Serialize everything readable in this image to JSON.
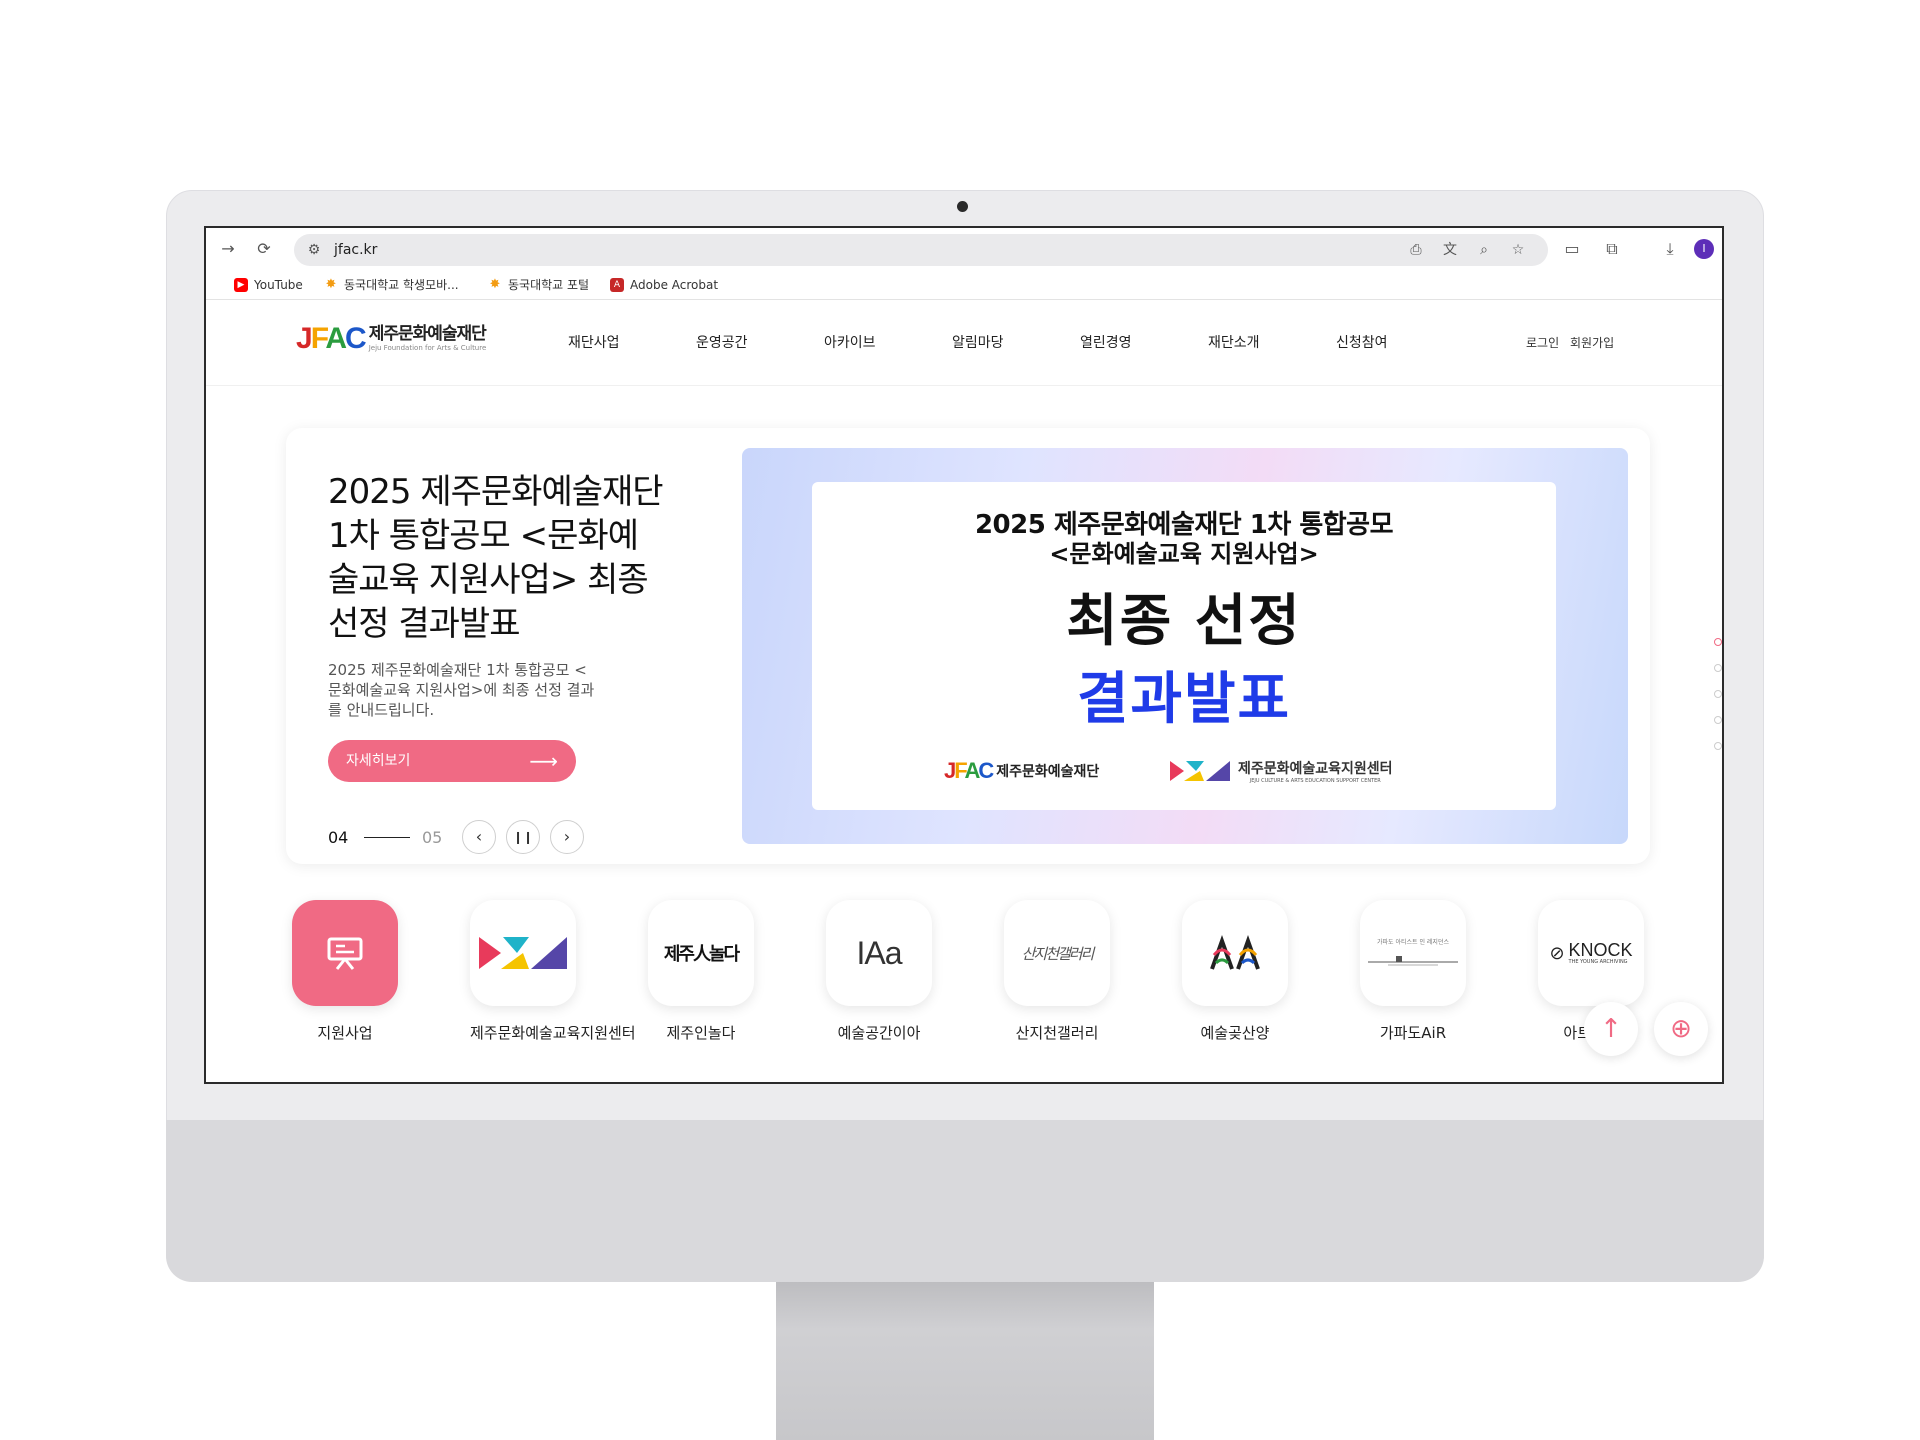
{
  "browser": {
    "url": "jfac.kr",
    "avatar_letter": "I",
    "bookmarks": [
      {
        "label": "YouTube",
        "icon": "youtube-icon",
        "color": "#ff0000"
      },
      {
        "label": "동국대학교 학생모바...",
        "icon": "dongguk-icon",
        "color": "#f39c12"
      },
      {
        "label": "동국대학교 포털",
        "icon": "dongguk-icon",
        "color": "#f39c12"
      },
      {
        "label": "Adobe Acrobat",
        "icon": "acrobat-icon",
        "color": "#c62828"
      }
    ]
  },
  "site": {
    "logo_mark": "JFAC",
    "logo_ko": "제주문화예술재단",
    "logo_en": "Jeju Foundation for Arts & Culture",
    "nav": [
      "재단사업",
      "운영공간",
      "아카이브",
      "알림마당",
      "열린경영",
      "재단소개",
      "신청참여"
    ],
    "util": {
      "login": "로그인",
      "signup": "회원가입"
    }
  },
  "hero": {
    "title": "2025 제주문화예술재단 1차 통합공모 <문화예술교육 지원사업> 최종선정 결과발표",
    "description": "2025 제주문화예술재단 1차 통합공모 <문화예술교육 지원사업>에 최종 선정 결과를 안내드립니다.",
    "button_label": "자세히보기",
    "current_slide": "04",
    "total_slides": "05",
    "banner": {
      "line1": "2025 제주문화예술재단 1차 통합공모",
      "line2": "<문화예술교육 지원사업>",
      "line3": "최종 선정",
      "line4": "결과발표",
      "logo_left": "제주문화예술재단",
      "logo_right": "제주문화예술교육지원센터",
      "logo_right_en": "JEJU CULTURE & ARTS EDUCATION SUPPORT CENTER"
    }
  },
  "quick_links": [
    {
      "label": "지원사업",
      "icon": "presentation-board-icon"
    },
    {
      "label": "제주문화예술교육지원센터",
      "icon": "arts-education-center-logo"
    },
    {
      "label": "제주인놀다",
      "icon": "jejuin-nolda-logo",
      "logo_text": "제주人놀다"
    },
    {
      "label": "예술공간이아",
      "icon": "iaa-logo",
      "logo_text": "IAa"
    },
    {
      "label": "산지천갤러리",
      "icon": "sanjicheon-gallery-logo",
      "logo_text": "산지천갤러리"
    },
    {
      "label": "예술곶산양",
      "icon": "art-cape-sanyang-logo"
    },
    {
      "label": "가파도AiR",
      "icon": "gapado-air-logo",
      "logo_text": "가파도 아티스트 인 레지던스"
    },
    {
      "label": "아트노크",
      "icon": "knock-logo",
      "logo_text": "KNOCK",
      "logo_sub": "THE YOUNG ARCHIVING"
    }
  ],
  "colors": {
    "accent": "#f06a84",
    "banner_blue": "#1f3be8"
  }
}
